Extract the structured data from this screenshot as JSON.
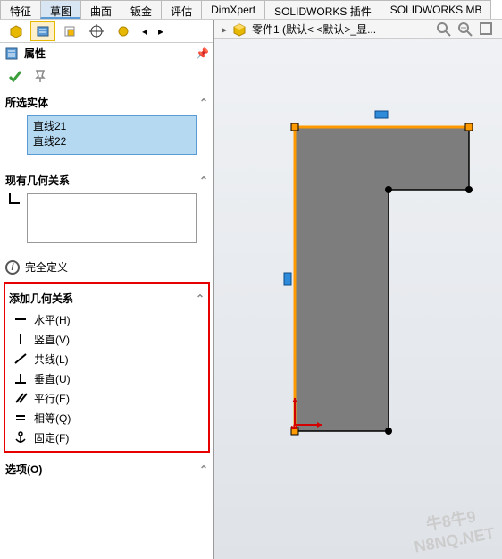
{
  "ribbon_tabs": [
    "特征",
    "草图",
    "曲面",
    "钣金",
    "评估",
    "DimXpert",
    "SOLIDWORKS 插件",
    "SOLIDWORKS MB"
  ],
  "active_ribbon_tab": 1,
  "property_panel": {
    "title": "属性",
    "selected_entities": {
      "label": "所选实体",
      "items": [
        "直线21",
        "直线22"
      ]
    },
    "existing_relations": {
      "label": "现有几何关系"
    },
    "status_text": "完全定义",
    "add_relations": {
      "label": "添加几何关系",
      "items": [
        {
          "key": "horizontal",
          "label": "水平(H)"
        },
        {
          "key": "vertical",
          "label": "竖直(V)"
        },
        {
          "key": "collinear",
          "label": "共线(L)"
        },
        {
          "key": "perpendicular",
          "label": "垂直(U)"
        },
        {
          "key": "parallel",
          "label": "平行(E)"
        },
        {
          "key": "equal",
          "label": "相等(Q)"
        },
        {
          "key": "fix",
          "label": "固定(F)"
        }
      ]
    },
    "options_label": "选项(O)"
  },
  "doc": {
    "name": "零件1  (默认< <默认>_显..."
  },
  "watermark": "牛8牛9\nN8NQ.NET"
}
